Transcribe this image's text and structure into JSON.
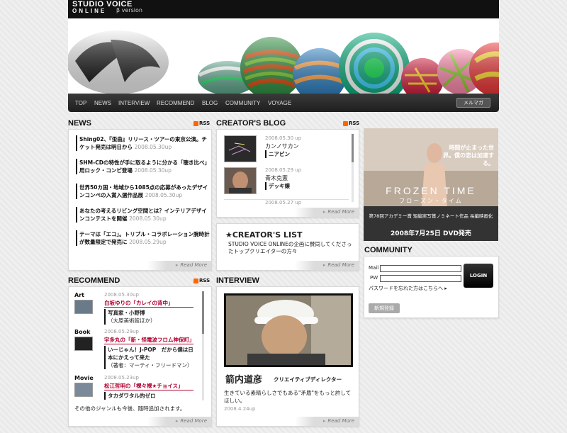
{
  "header": {
    "logo_line1": "STUDIO VOICE",
    "logo_line2": "ONLINE",
    "beta": "β version"
  },
  "nav": {
    "items": [
      "TOP",
      "NEWS",
      "INTERVIEW",
      "RECOMMEND",
      "BLOG",
      "COMMUNITY",
      "VOYAGE"
    ],
    "mail": "メルマガ"
  },
  "news": {
    "title": "NEWS",
    "rss": "RSS",
    "more": "Read More",
    "items": [
      {
        "text": "Shing02、『歪曲』リリース・ツアーの東京公演。チケット発売は明日から",
        "date": "2008.05.30up"
      },
      {
        "text": "SHM-CDの特性が手に取るように分かる「聴き比べ」用ロック・コンピ登場",
        "date": "2008.05.30up"
      },
      {
        "text": "世界50カ国・地域から1085点の応募があったデザインコンペの入賞入選作品展",
        "date": "2008.05.30up"
      },
      {
        "text": "あなたの考えるリビング空間とは？インテリアデザインコンテストを開催",
        "date": "2008.05.30up"
      },
      {
        "text": "テーマは「エコ」。トリプル・コラボレーション腕時計が数量限定で発売に",
        "date": "2008.05.29up"
      }
    ]
  },
  "blog": {
    "title": "CREATOR'S BLOG",
    "rss": "RSS",
    "more": "Read More",
    "items": [
      {
        "date": "2008.05.30 up",
        "name": "カンノサカン",
        "title": "ニアピン"
      },
      {
        "date": "2008.05.29 up",
        "name": "青木克憲",
        "title": "デッキ嬢"
      },
      {
        "date": "2008.05.27 up"
      }
    ]
  },
  "creators_list": {
    "title": "★CREATOR'S LIST",
    "desc": "STUDIO VOICE ONLINEの企画に賛同してくださったトップクリエイターの方々",
    "more": "Read More"
  },
  "recommend": {
    "title": "RECOMMEND",
    "rss": "RSS",
    "more": "Read More",
    "items": [
      {
        "cat": "Art",
        "date": "2008.05.30up",
        "title": "白坂ゆりの「カレイの背中」",
        "sub": "写真家・小野博",
        "sub2": "（大原美術館ほか）"
      },
      {
        "cat": "Book",
        "date": "2008.05.29up",
        "title": "宇多丸の「新・怪電波フロム神保町」",
        "sub": "いーじゃん！J-POP　だから僕は日本にかえって来た",
        "sub2": "（著者：マーティ・フリードマン）"
      },
      {
        "cat": "Movie",
        "date": "2008.05.23up",
        "title": "松江哲明の「裸々裸★チョイス」",
        "sub": "タカダワタル的ゼロ"
      }
    ],
    "footer": "その他のジャンルも今後、随時追加されます。"
  },
  "interview": {
    "title": "INTERVIEW",
    "name": "箭内道彦",
    "role": "クリエイティブディレクター",
    "desc": "生きている素晴らしさでもある\"矛盾\"をもっと許してほしい。",
    "date": "2008.4.24up",
    "more": "Read More"
  },
  "ad": {
    "title": "FROZEN TIME",
    "kana": "フローズン・タイム",
    "top_copy": "時間が止まった世界。僕の恋は加速する。",
    "award": "第78回アカデミー賞 短編実写賞ノミネート作品 長編映画化",
    "release": "2008年7月25日 DVD発売"
  },
  "community": {
    "title": "COMMUNITY",
    "mail_label": "Mail",
    "pw_label": "PW",
    "login": "LOGIN",
    "forgot": "パスワードを忘れた方はこちらへ",
    "register": "新規登録"
  }
}
